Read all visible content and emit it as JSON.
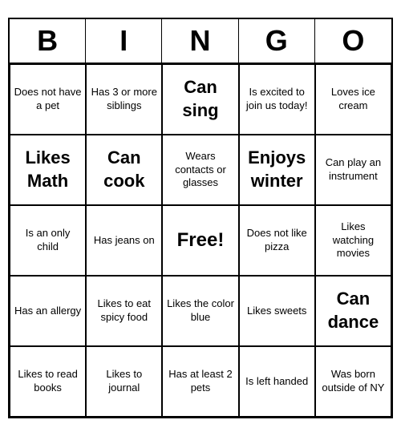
{
  "header": {
    "letters": [
      "B",
      "I",
      "N",
      "G",
      "O"
    ]
  },
  "cells": [
    {
      "text": "Does not have a pet",
      "large": false
    },
    {
      "text": "Has 3 or more siblings",
      "large": false
    },
    {
      "text": "Can sing",
      "large": true
    },
    {
      "text": "Is excited to join us today!",
      "large": false
    },
    {
      "text": "Loves ice cream",
      "large": false
    },
    {
      "text": "Likes Math",
      "large": true
    },
    {
      "text": "Can cook",
      "large": true
    },
    {
      "text": "Wears contacts or glasses",
      "large": false
    },
    {
      "text": "Enjoys winter",
      "large": true
    },
    {
      "text": "Can play an instrument",
      "large": false
    },
    {
      "text": "Is an only child",
      "large": false
    },
    {
      "text": "Has jeans on",
      "large": false
    },
    {
      "text": "Free!",
      "large": false,
      "free": true
    },
    {
      "text": "Does not like pizza",
      "large": false
    },
    {
      "text": "Likes watching movies",
      "large": false
    },
    {
      "text": "Has an allergy",
      "large": false
    },
    {
      "text": "Likes to eat spicy food",
      "large": false
    },
    {
      "text": "Likes the color blue",
      "large": false
    },
    {
      "text": "Likes sweets",
      "large": false
    },
    {
      "text": "Can dance",
      "large": true
    },
    {
      "text": "Likes to read books",
      "large": false
    },
    {
      "text": "Likes to journal",
      "large": false
    },
    {
      "text": "Has at least 2 pets",
      "large": false
    },
    {
      "text": "Is left handed",
      "large": false
    },
    {
      "text": "Was born outside of NY",
      "large": false
    }
  ]
}
